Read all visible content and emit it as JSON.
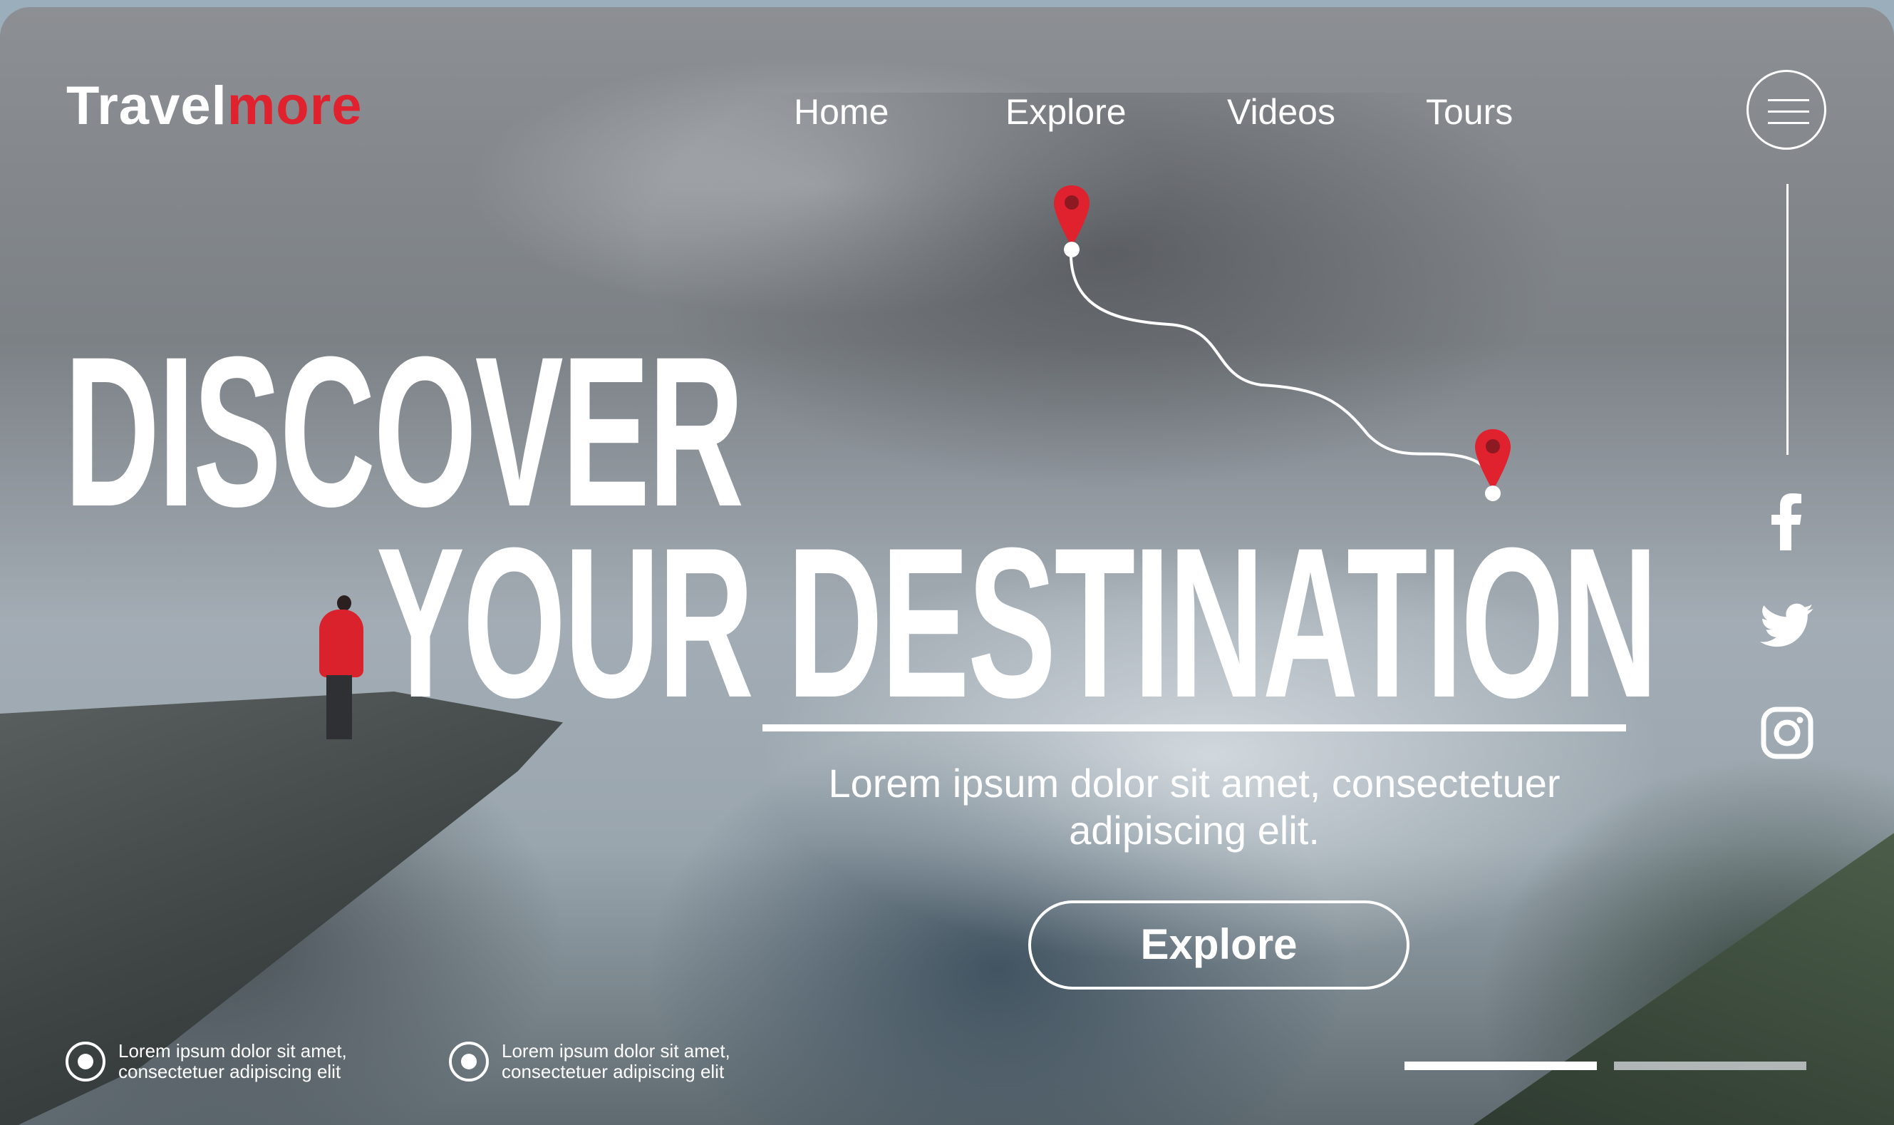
{
  "brand": {
    "name_part1": "Travel",
    "name_part2": "more",
    "accent_color": "#e0212e"
  },
  "nav": {
    "items": [
      {
        "label": "Home"
      },
      {
        "label": "Explore"
      },
      {
        "label": "Videos"
      },
      {
        "label": "Tours"
      }
    ],
    "menu_icon": "hamburger-menu-icon"
  },
  "hero": {
    "line1": "DISCOVER",
    "line2": "YOUR DESTINATION",
    "subtitle": "Lorem ipsum dolor sit amet, consectetuer adipiscing elit.",
    "cta_label": "Explore"
  },
  "route": {
    "start_icon": "map-pin-icon",
    "end_icon": "map-pin-icon"
  },
  "social": [
    {
      "icon": "facebook-icon"
    },
    {
      "icon": "twitter-icon"
    },
    {
      "icon": "instagram-icon"
    }
  ],
  "features": [
    {
      "text_line1": "Lorem ipsum dolor sit amet,",
      "text_line2": "consectetuer adipiscing elit"
    },
    {
      "text_line1": "Lorem ipsum dolor sit amet,",
      "text_line2": "consectetuer adipiscing elit"
    }
  ],
  "slider": {
    "active_index": 0,
    "count": 2
  }
}
